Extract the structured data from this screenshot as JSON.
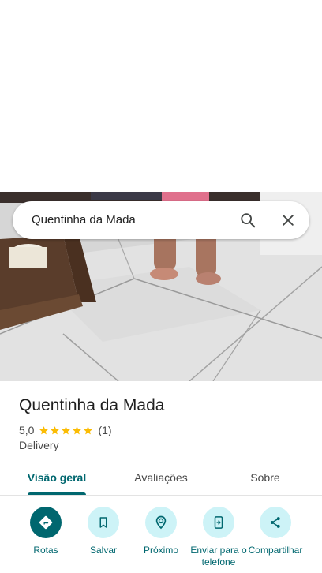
{
  "search": {
    "query": "Quentinha da Mada",
    "search_icon": "search-icon",
    "close_icon": "close-icon"
  },
  "place": {
    "name": "Quentinha da Mada",
    "rating": "5,0",
    "stars": 5,
    "review_count": "(1)",
    "category": "Delivery"
  },
  "tabs": [
    {
      "label": "Visão geral",
      "active": true
    },
    {
      "label": "Avaliações",
      "active": false
    },
    {
      "label": "Sobre",
      "active": false
    }
  ],
  "actions": [
    {
      "label": "Rotas",
      "icon": "directions-icon"
    },
    {
      "label": "Salvar",
      "icon": "bookmark-icon"
    },
    {
      "label": "Próximo",
      "icon": "nearby-icon"
    },
    {
      "label": "Enviar para o telefone",
      "icon": "send-to-phone-icon"
    },
    {
      "label": "Compartilhar",
      "icon": "share-icon"
    }
  ],
  "colors": {
    "accent": "#00676f",
    "action_bg": "#cdf3f7",
    "star": "#fbbc04"
  }
}
